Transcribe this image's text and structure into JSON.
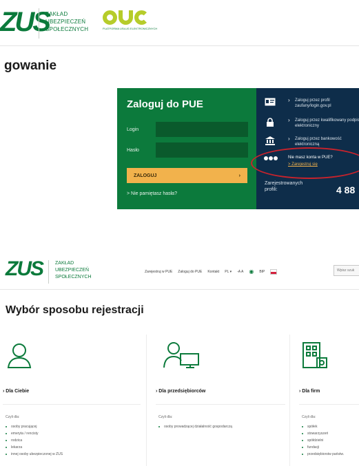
{
  "top_header": {
    "zus_logo": "ZUS",
    "zus_name": [
      "ZAKŁAD",
      "UBEZPIECZEŃ",
      "SPOŁECZNYCH"
    ],
    "pue_logo": "PUE",
    "pue_sub": "PLATFORMA USŁUG ELEKTRONICZNYCH"
  },
  "top_page_title": "gowanie",
  "login": {
    "title": "Zaloguj do PUE",
    "login_label": "Login",
    "password_label": "Hasło",
    "button_label": "ZALOGUJ",
    "forgot": "> Nie pamiętasz hasła?"
  },
  "side_panel": {
    "items": [
      {
        "icon": "id-card-icon",
        "text": "Zaloguj przez profil zaufany/login.gov.pl"
      },
      {
        "icon": "lock-icon",
        "text": "Zaloguj przez kwalifikowany podpis elektroniczny"
      },
      {
        "icon": "bank-icon",
        "text": "Zaloguj przez bankowość elektroniczną"
      }
    ],
    "no_account": "Nie masz konta w PUE?",
    "register": "> Zarejestruj się",
    "count_label": "Zarejestrowanych profili:",
    "count_value": "4 88"
  },
  "mid_header": {
    "zus_logo": "ZUS",
    "zus_name": [
      "ZAKŁAD",
      "UBEZPIECZEŃ",
      "SPOŁECZNYCH"
    ],
    "nav": [
      "Zarejestruj w PUE",
      "Zaloguj do PUE",
      "Kontakt"
    ],
    "lang": "PL ▾",
    "font_size": "-A A",
    "bip": "BIP",
    "search_placeholder": "Wpisz szuk"
  },
  "registration": {
    "title": "Wybór sposobu rejestracji",
    "columns": [
      {
        "icon": "person-icon",
        "heading": "› Dla Ciebie",
        "sub": "Czyli dla:",
        "items": [
          "osoby pracującej",
          "emeryta / rencisty",
          "rodzica",
          "lekarza",
          "innej osoby ubezpieczonej w ZUS"
        ]
      },
      {
        "icon": "entrepreneur-icon",
        "heading": "› Dla przedsiębiorców",
        "sub": "Czyli dla:",
        "items": [
          "osoby prowadzącej działalność gospodarczą"
        ]
      },
      {
        "icon": "building-icon",
        "heading": "› Dla firm",
        "sub": "Czyli dla:",
        "items": [
          "spółek",
          "stowarzyszeń",
          "spółdzielni",
          "fundacji",
          "przedsiębiorstw państw."
        ]
      }
    ]
  },
  "colors": {
    "zus_green": "#0b7a3c",
    "pue_lime": "#b6cc2a",
    "side_navy": "#0e2d4a",
    "button_orange": "#f2b24c",
    "highlight_red": "#c8232c"
  }
}
